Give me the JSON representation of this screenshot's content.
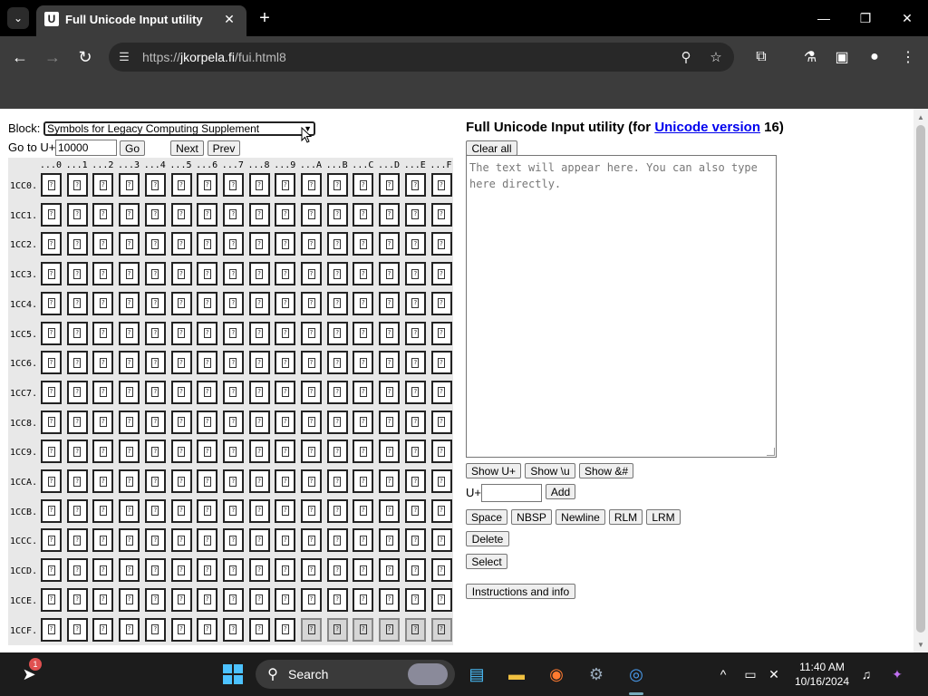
{
  "browser": {
    "tab_title": "Full Unicode Input utility",
    "tab_favicon_letter": "U",
    "url_scheme": "https://",
    "url_host": "jkorpela.fi",
    "url_path": "/fui.html8"
  },
  "page": {
    "block_label": "Block:",
    "block_selected": "Symbols for Legacy Computing Supplement",
    "goto_label": "Go to U+",
    "goto_value": "10000",
    "go_button": "Go",
    "next_button": "Next",
    "prev_button": "Prev",
    "grid": {
      "col_headers": [
        "...0",
        "...1",
        "...2",
        "...3",
        "...4",
        "...5",
        "...6",
        "...7",
        "...8",
        "...9",
        "...A",
        "...B",
        "...C",
        "...D",
        "...E",
        "...F"
      ],
      "row_headers": [
        "1CC0.",
        "1CC1.",
        "1CC2.",
        "1CC3.",
        "1CC4.",
        "1CC5.",
        "1CC6.",
        "1CC7.",
        "1CC8.",
        "1CC9.",
        "1CCA.",
        "1CCB.",
        "1CCC.",
        "1CCD.",
        "1CCE.",
        "1CCF."
      ],
      "glyph": "?",
      "unassigned_last_row_from_col": 10
    },
    "title_prefix": "Full Unicode Input utility (for ",
    "title_link": "Unicode version",
    "title_suffix": " 16)",
    "clear_all_button": "Clear all",
    "textarea_placeholder": "The text will appear here. You can also type here directly.",
    "show_uplus_button": "Show U+",
    "show_u_button": "Show \\u",
    "show_amp_button": "Show &#",
    "uplus_label": "U+",
    "add_button": "Add",
    "space_button": "Space",
    "nbsp_button": "NBSP",
    "newline_button": "Newline",
    "rlm_button": "RLM",
    "lrm_button": "LRM",
    "delete_button": "Delete",
    "select_button": "Select",
    "instructions_button": "Instructions and info"
  },
  "taskbar": {
    "search_label": "Search",
    "notification_count": "1",
    "time": "11:40 AM",
    "date": "10/16/2024"
  }
}
